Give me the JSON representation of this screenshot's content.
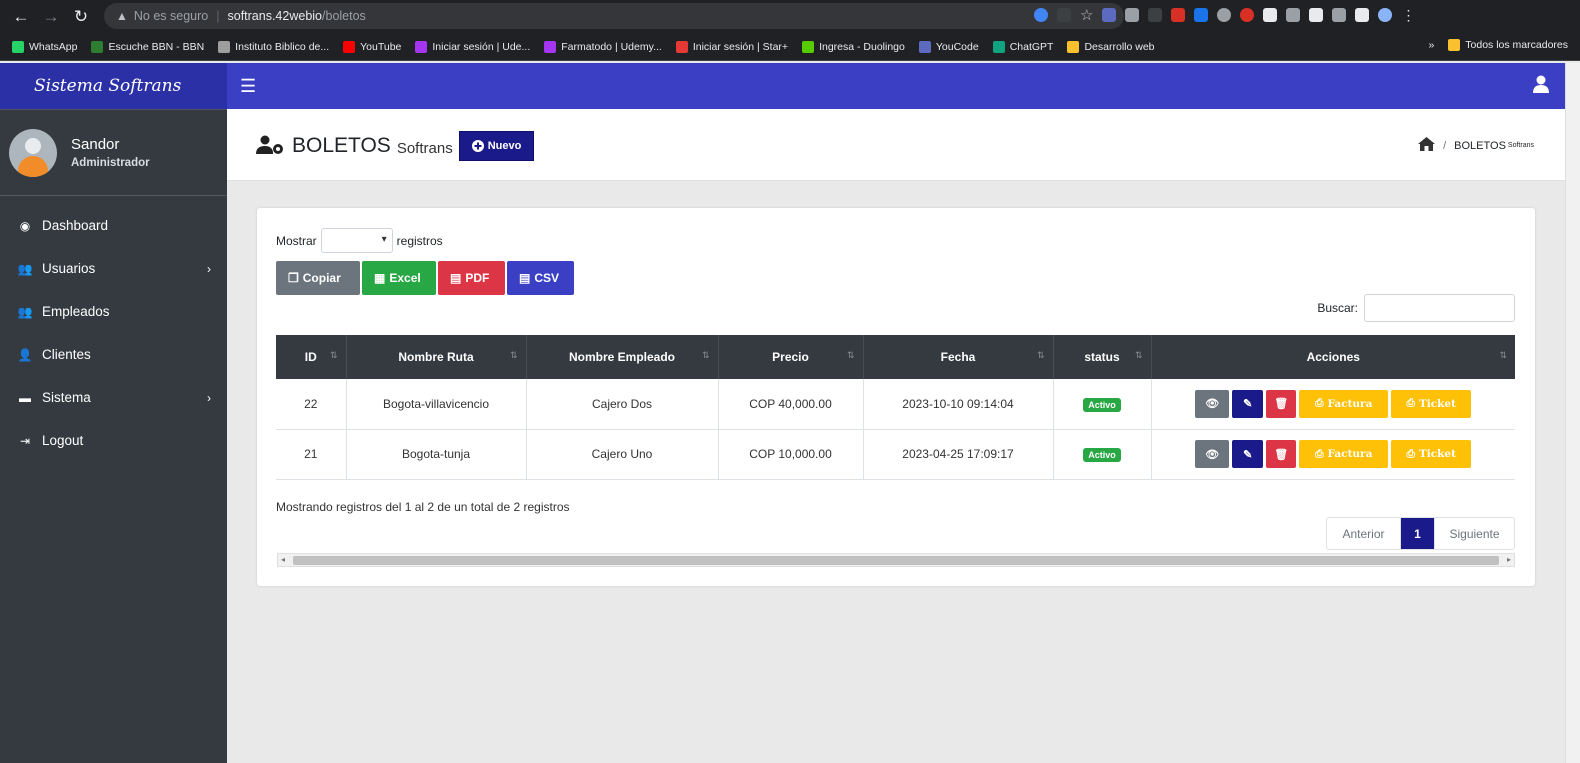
{
  "browser": {
    "security": "No es seguro",
    "host": "softrans.42webio",
    "path": "/boletos",
    "bookmarks": [
      {
        "label": "WhatsApp",
        "color": "#25d366"
      },
      {
        "label": "Escuche BBN - BBN",
        "color": "#2e7d32"
      },
      {
        "label": "Instituto Biblico de...",
        "color": "#9e9e9e"
      },
      {
        "label": "YouTube",
        "color": "#ff0000"
      },
      {
        "label": "Iniciar sesión | Ude...",
        "color": "#a435f0"
      },
      {
        "label": "Farmatodo | Udemy...",
        "color": "#a435f0"
      },
      {
        "label": "Iniciar sesión | Star+",
        "color": "#e53935"
      },
      {
        "label": "Ingresa - Duolingo",
        "color": "#58cc02"
      },
      {
        "label": "YouCode",
        "color": "#5c6bc0"
      },
      {
        "label": "ChatGPT",
        "color": "#10a37f"
      },
      {
        "label": "Desarrollo web",
        "color": "#fbc02d"
      }
    ],
    "bookmarks_more": "»",
    "all_bookmarks": "Todos los marcadores"
  },
  "brand": "Sistema Softrans",
  "user": {
    "name": "Sandor",
    "role": "Administrador"
  },
  "nav": [
    {
      "label": "Dashboard",
      "icon": "dashboard-icon",
      "glyph": "◉",
      "has_children": false
    },
    {
      "label": "Usuarios",
      "icon": "users-icon",
      "glyph": "👥",
      "has_children": true
    },
    {
      "label": "Empleados",
      "icon": "users-icon",
      "glyph": "👥",
      "has_children": false
    },
    {
      "label": "Clientes",
      "icon": "user-icon",
      "glyph": "👤",
      "has_children": false
    },
    {
      "label": "Sistema",
      "icon": "window-icon",
      "glyph": "▬",
      "has_children": true
    },
    {
      "label": "Logout",
      "icon": "logout-icon",
      "glyph": "⇥",
      "has_children": false
    }
  ],
  "header": {
    "title": "BOLETOS",
    "subtitle": "Softrans",
    "new_button": "Nuevo",
    "breadcrumb_home": "home-icon",
    "breadcrumb_current": "BOLETOS",
    "breadcrumb_current_small": "Softrans"
  },
  "table_controls": {
    "show_label": "Mostrar",
    "records_label": "registros",
    "length_value": "",
    "search_label": "Buscar:",
    "search_value": "",
    "export_buttons": {
      "copy": "Copiar",
      "excel": "Excel",
      "pdf": "PDF",
      "csv": "CSV"
    }
  },
  "table": {
    "columns": [
      "ID",
      "Nombre Ruta",
      "Nombre Empleado",
      "Precio",
      "Fecha",
      "status",
      "Acciones"
    ],
    "rows": [
      {
        "id": "22",
        "ruta": "Bogota-villavicencio",
        "empleado": "Cajero Dos",
        "precio": "COP 40,000.00",
        "fecha": "2023-10-10 09:14:04",
        "status": "Activo"
      },
      {
        "id": "21",
        "ruta": "Bogota-tunja",
        "empleado": "Cajero Uno",
        "precio": "COP 10,000.00",
        "fecha": "2023-04-25 17:09:17",
        "status": "Activo"
      }
    ],
    "actions": {
      "factura": "Factura",
      "ticket": "Ticket"
    }
  },
  "footer": {
    "info": "Mostrando registros del 1 al 2 de un total de 2 registros",
    "prev": "Anterior",
    "current_page": "1",
    "next": "Siguiente"
  },
  "colors": {
    "topbar": "#3b3fc4",
    "brand": "#2c30a6",
    "sidebar": "#343a40",
    "primary_dark": "#1a1a8a"
  }
}
